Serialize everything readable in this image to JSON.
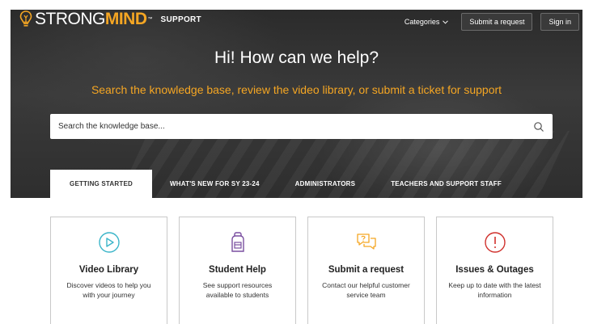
{
  "header": {
    "logo_strong": "STRONG",
    "logo_mind": "MIND",
    "logo_tm": "™",
    "logo_support": "SUPPORT",
    "nav": {
      "categories_label": "Categories",
      "submit_request_label": "Submit a request",
      "sign_in_label": "Sign in"
    }
  },
  "hero": {
    "title": "Hi! How can we help?",
    "subtitle": "Search the knowledge base, review the video library, or submit a ticket for support"
  },
  "search": {
    "placeholder": "Search the knowledge base..."
  },
  "tabs": [
    {
      "label": "GETTING STARTED",
      "active": true
    },
    {
      "label": "WHAT'S NEW FOR SY 23-24",
      "active": false
    },
    {
      "label": "ADMINISTRATORS",
      "active": false
    },
    {
      "label": "TEACHERS AND SUPPORT STAFF",
      "active": false
    }
  ],
  "cards": [
    {
      "icon": "play-circle-icon",
      "title": "Video Library",
      "description": "Discover videos to help you with your journey"
    },
    {
      "icon": "backpack-icon",
      "title": "Student Help",
      "description": "See support resources available to students"
    },
    {
      "icon": "chat-question-icon",
      "title": "Submit a request",
      "description": "Contact our helpful customer service team"
    },
    {
      "icon": "alert-circle-icon",
      "title": "Issues & Outages",
      "description": "Keep up to date with the latest information"
    }
  ],
  "colors": {
    "accent_orange": "#f5a623",
    "teal": "#3bb5c9",
    "purple": "#7a4fa0",
    "red": "#d0312d"
  }
}
